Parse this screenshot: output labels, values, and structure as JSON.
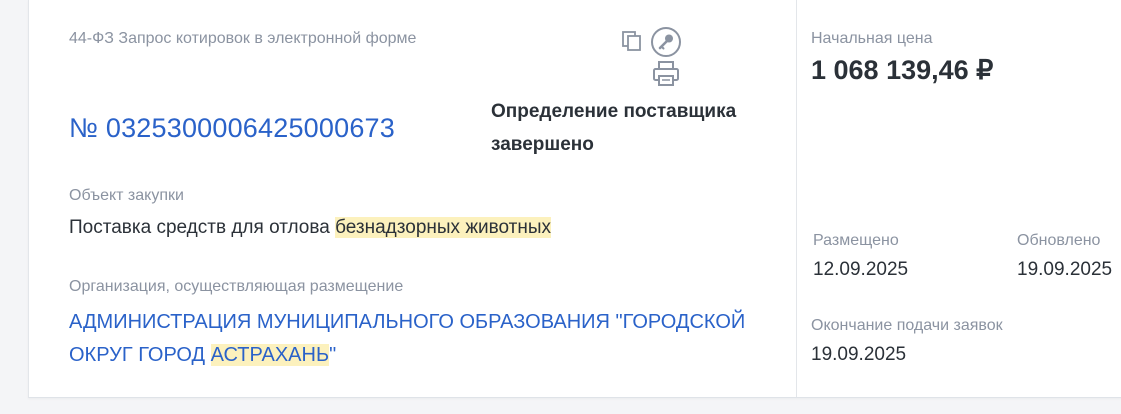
{
  "purchase": {
    "law_type": "44-ФЗ Запрос котировок в электронной форме",
    "number": "№ 0325300006425000673",
    "status_line1": "Определение поставщика",
    "status_line2": "завершено",
    "object_label": "Объект закупки",
    "object_text_plain": "Поставка средств для отлова ",
    "object_text_highlight": "безнадзорных животных",
    "org_label": "Организация, осуществляющая размещение",
    "org_text_plain": "АДМИНИСТРАЦИЯ МУНИЦИПАЛЬНОГО ОБРАЗОВАНИЯ \"ГОРОДСКОЙ ОКРУГ ГОРОД ",
    "org_text_highlight": "АСТРАХАНЬ",
    "org_text_tail": "\""
  },
  "actions": {
    "copy_icon": "copy-icon",
    "key_icon": "key-icon",
    "print_icon": "printer-icon"
  },
  "side": {
    "price_label": "Начальная цена",
    "price_value": "1 068 139,46 ₽",
    "published_label": "Размещено",
    "published_date": "12.09.2025",
    "updated_label": "Обновлено",
    "updated_date": "19.09.2025",
    "deadline_label": "Окончание подачи заявок",
    "deadline_date": "19.09.2025"
  },
  "colors": {
    "link_blue": "#2a62c9",
    "highlight": "#fcf1bd",
    "muted_text": "#8b93a1",
    "dark_text": "#2b3138"
  }
}
